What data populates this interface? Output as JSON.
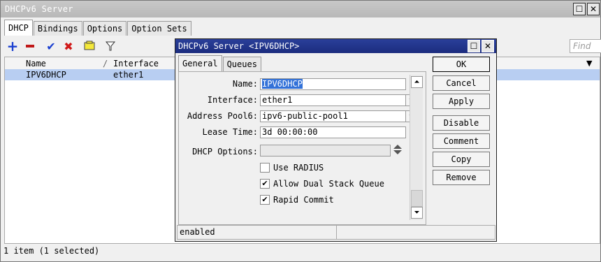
{
  "window": {
    "title": "DHCPv6 Server",
    "restore_glyph": "☐",
    "close_glyph": "✕"
  },
  "tabs": [
    "DHCP",
    "Bindings",
    "Options",
    "Option Sets"
  ],
  "toolbar": {
    "icons": [
      "add-icon",
      "remove-icon",
      "enable-icon",
      "disable-icon",
      "comment-icon",
      "filter-icon"
    ],
    "find_placeholder": "Find"
  },
  "table": {
    "columns": [
      "Name",
      "Interface"
    ],
    "sort_marker": "/",
    "rows": [
      {
        "name": "IPV6DHCP",
        "interface": "ether1",
        "selected": true
      }
    ]
  },
  "status": "1 item (1 selected)",
  "dialog": {
    "title": "DHCPv6 Server <IPV6DHCP>",
    "tabs": [
      "General",
      "Queues"
    ],
    "fields": {
      "name_label": "Name:",
      "name_value": "IPV6DHCP",
      "interface_label": "Interface:",
      "interface_value": "ether1",
      "pool_label": "Address Pool6:",
      "pool_value": "ipv6-public-pool1",
      "lease_label": "Lease Time:",
      "lease_value": "3d 00:00:00",
      "options_label": "DHCP Options:",
      "options_value": ""
    },
    "checkboxes": [
      {
        "label": "Use RADIUS",
        "checked": false
      },
      {
        "label": "Allow Dual Stack Queue",
        "checked": true
      },
      {
        "label": "Rapid Commit",
        "checked": true
      }
    ],
    "check_glyph": "✔",
    "buttons": [
      "OK",
      "Cancel",
      "Apply",
      "Disable",
      "Comment",
      "Copy",
      "Remove"
    ],
    "status": "enabled"
  },
  "colors": {
    "dialog_title": "#1f3388",
    "selection": "#b8cef2",
    "text_selection": "#3271d8",
    "add": "#1a3fd0",
    "remove": "#c01818",
    "enable": "#1a3fd0",
    "disable": "#d01818"
  }
}
